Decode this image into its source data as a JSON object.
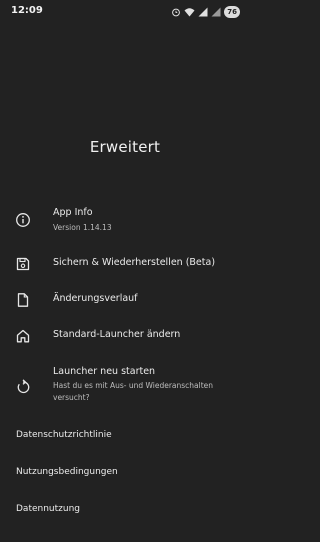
{
  "status_bar": {
    "time": "12:09",
    "battery": "76",
    "icons": [
      "alarm-icon",
      "wifi-icon",
      "signal-icon",
      "signal-icon"
    ]
  },
  "page": {
    "title": "Erweitert"
  },
  "items": [
    {
      "icon": "info-icon",
      "label": "App Info",
      "sub": "Version 1.14.13"
    },
    {
      "icon": "save-icon",
      "label": "Sichern & Wiederherstellen (Beta)"
    },
    {
      "icon": "file-icon",
      "label": "Änderungsverlauf"
    },
    {
      "icon": "home-icon",
      "label": "Standard-Launcher ändern"
    },
    {
      "icon": "restart-icon",
      "label": "Launcher neu starten",
      "sub": "Hast du es mit Aus- und Wiederanschalten versucht?"
    }
  ],
  "links": [
    "Datenschutzrichtlinie",
    "Nutzungsbedingungen",
    "Datennutzung"
  ]
}
